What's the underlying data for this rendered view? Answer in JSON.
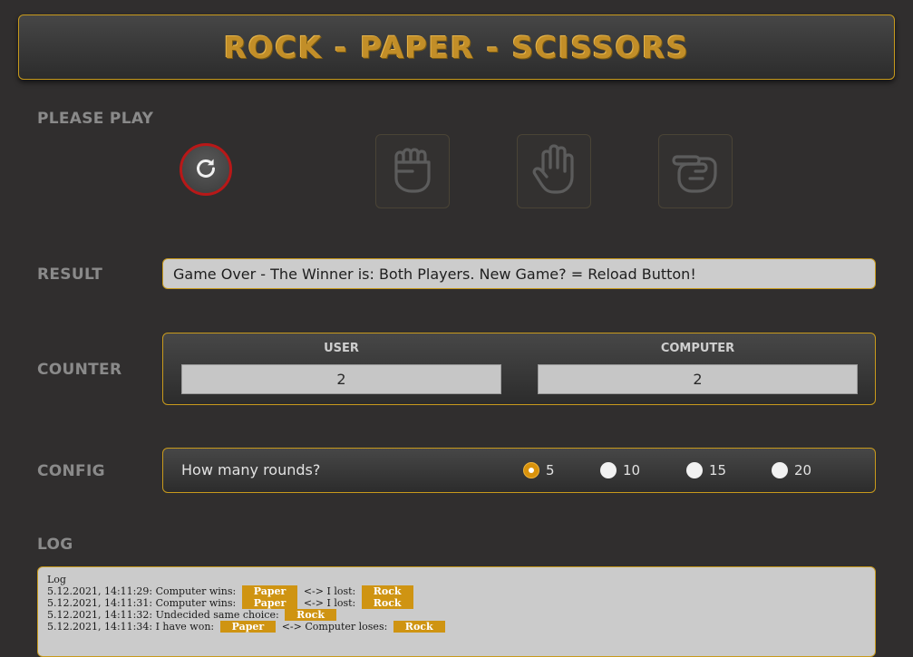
{
  "header": {
    "title": "ROCK - PAPER - SCISSORS"
  },
  "play": {
    "label": "PLEASE PLAY",
    "reload_icon": "reload-icon",
    "choices": [
      {
        "name": "rock",
        "icon": "fist-icon"
      },
      {
        "name": "paper",
        "icon": "open-hand-icon"
      },
      {
        "name": "scissors",
        "icon": "scissors-hand-icon"
      }
    ]
  },
  "result": {
    "label": "RESULT",
    "text": "Game Over - The Winner is: Both Players. New Game? = Reload Button!"
  },
  "counter": {
    "label": "COUNTER",
    "user_label": "USER",
    "user_value": "2",
    "computer_label": "COMPUTER",
    "computer_value": "2"
  },
  "config": {
    "label": "CONFIG",
    "question": "How many rounds?",
    "options": [
      "5",
      "10",
      "15",
      "20"
    ],
    "selected": "5"
  },
  "log": {
    "label": "LOG",
    "title": "Log",
    "entries": [
      {
        "prefix": "5.12.2021, 14:11:29: Computer wins:",
        "first": "Paper",
        "middle": "<-> I lost:",
        "second": "Rock"
      },
      {
        "prefix": "5.12.2021, 14:11:31: Computer wins:",
        "first": "Paper",
        "middle": "<-> I lost:",
        "second": "Rock"
      },
      {
        "prefix": "5.12.2021, 14:11:32: Undecided same choice:",
        "first": "Rock",
        "middle": "",
        "second": ""
      },
      {
        "prefix": "5.12.2021, 14:11:34: I have won:",
        "first": "Paper",
        "middle": "<-> Computer loses:",
        "second": "Rock"
      }
    ]
  },
  "colors": {
    "accent": "#c89a1c",
    "background": "#302e2e",
    "tag": "#cf9412",
    "reload_ring": "#b81818"
  }
}
